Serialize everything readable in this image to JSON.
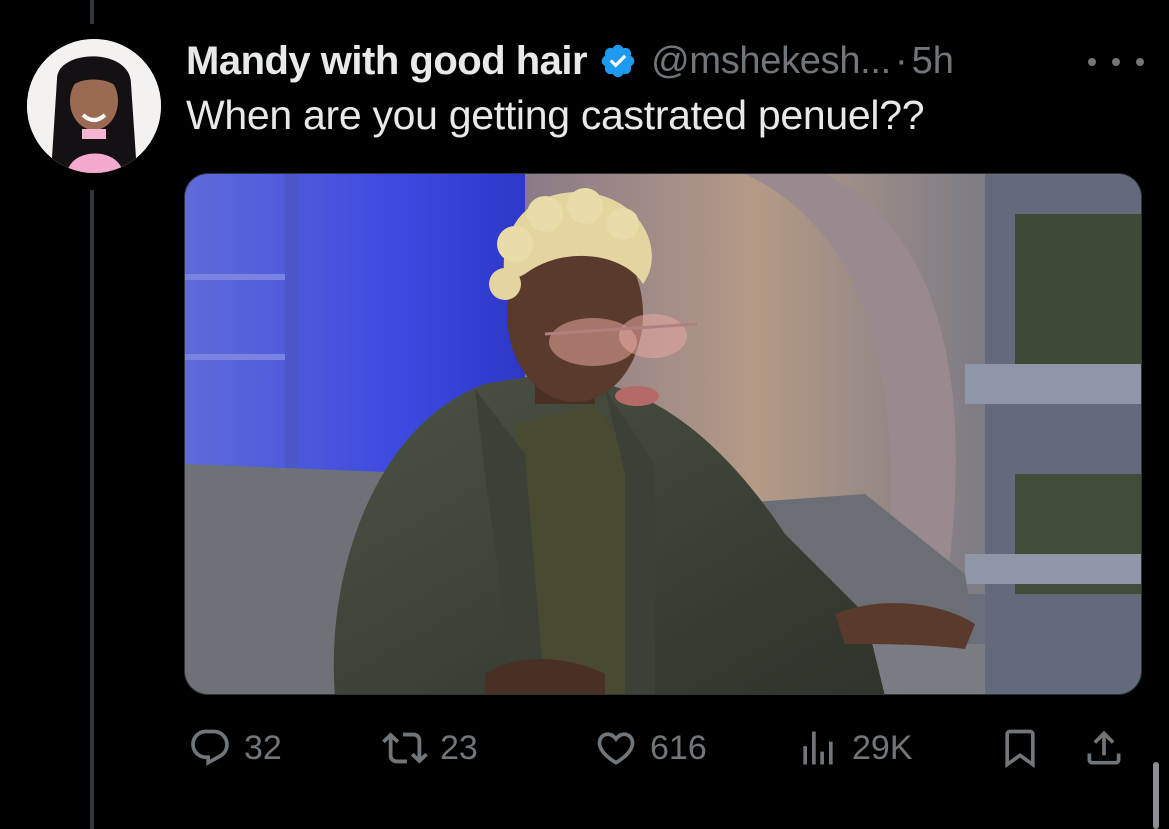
{
  "tweet": {
    "author_name": "Mandy with good hair",
    "verified": true,
    "handle": "@mshekesh...",
    "separator": "·",
    "timestamp": "5h",
    "text": "When are you getting castrated penuel??",
    "avatar_icon": "profile-photo",
    "media_description": "photo"
  },
  "actions": {
    "replies": "32",
    "reposts": "23",
    "likes": "616",
    "views": "29K",
    "reply_icon": "speech-bubble-icon",
    "repost_icon": "repost-arrows-icon",
    "like_icon": "heart-icon",
    "views_icon": "bar-chart-icon",
    "bookmark_icon": "bookmark-icon",
    "share_icon": "share-icon"
  },
  "colors": {
    "background": "#000000",
    "text_primary": "#e7e9ea",
    "text_secondary": "#71767b",
    "verified_blue": "#1d9bf0"
  }
}
